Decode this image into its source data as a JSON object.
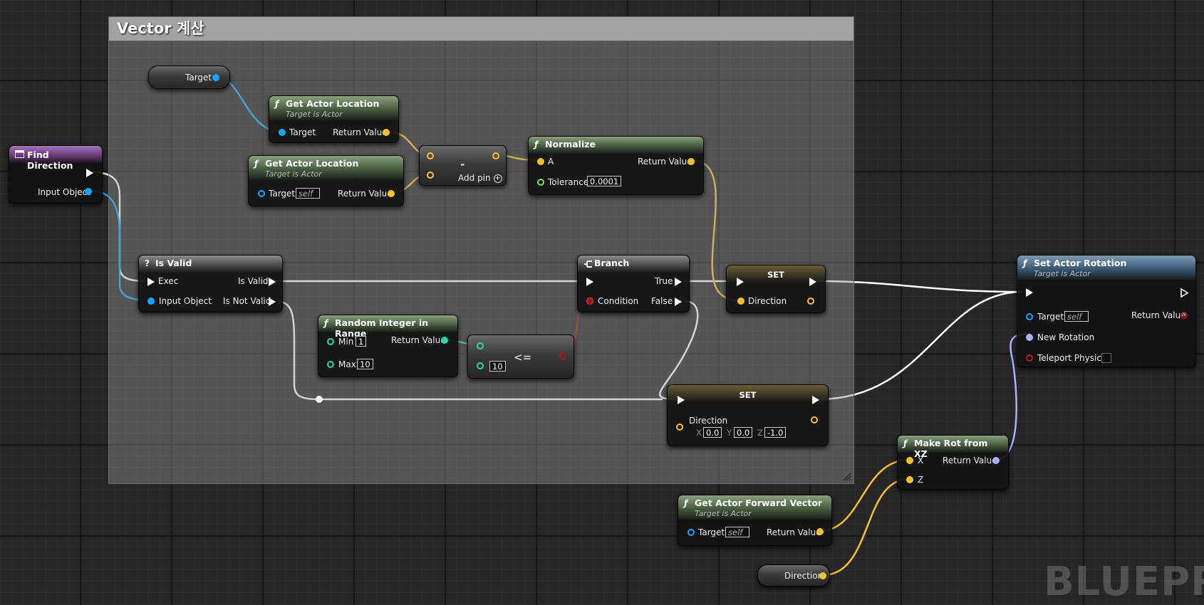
{
  "comment": {
    "title": "Vector 계산"
  },
  "watermark": "BLUEPRI",
  "nodes": {
    "find_direction": {
      "title": "Find Direction",
      "input_object": "Input Object"
    },
    "target_var": {
      "label": "Target"
    },
    "get_loc_1": {
      "title": "Get Actor Location",
      "subtitle": "Target is Actor",
      "target": "Target",
      "return": "Return Value"
    },
    "get_loc_2": {
      "title": "Get Actor Location",
      "subtitle": "Target is Actor",
      "target": "Target",
      "target_value": "self",
      "return": "Return Value"
    },
    "subtract": {
      "symbol": "-",
      "add_pin": "Add pin"
    },
    "normalize": {
      "title": "Normalize",
      "a": "A",
      "return": "Return Value",
      "tolerance": "Tolerance",
      "tolerance_value": "0.0001"
    },
    "is_valid": {
      "title": "Is Valid",
      "exec": "Exec",
      "input_object": "Input Object",
      "is_valid": "Is Valid",
      "is_not_valid": "Is Not Valid"
    },
    "branch": {
      "title": "Branch",
      "condition": "Condition",
      "true": "True",
      "false": "False"
    },
    "set_1": {
      "title": "SET",
      "direction": "Direction"
    },
    "random_int": {
      "title": "Random Integer in Range",
      "min": "Min",
      "min_value": "1",
      "max": "Max",
      "max_value": "10",
      "return": "Return Value"
    },
    "compare": {
      "symbol": "<=",
      "b_value": "10"
    },
    "set_2": {
      "title": "SET",
      "direction": "Direction",
      "x_label": "X",
      "x": "0.0",
      "y_label": "Y",
      "y": "0.0",
      "z_label": "Z",
      "z": "-1.0"
    },
    "set_rotation": {
      "title": "Set Actor Rotation",
      "subtitle": "Target is Actor",
      "target": "Target",
      "target_value": "self",
      "return": "Return Value",
      "new_rotation": "New Rotation",
      "teleport": "Teleport Physics"
    },
    "make_rot": {
      "title": "Make Rot from XZ",
      "x": "X",
      "z": "Z",
      "return": "Return Value"
    },
    "forward_vec": {
      "title": "Get Actor Forward Vector",
      "subtitle": "Target is Actor",
      "target": "Target",
      "target_value": "self",
      "return": "Return Value"
    },
    "direction_var": {
      "label": "Direction"
    }
  },
  "pin_colors": {
    "exec": "#ffffff",
    "object": "#0fa7ff",
    "vector": "#f9c02b",
    "float": "#7be62a",
    "integer": "#28d6a9",
    "bool": "#b01818",
    "rotator": "#a8b0ff"
  }
}
